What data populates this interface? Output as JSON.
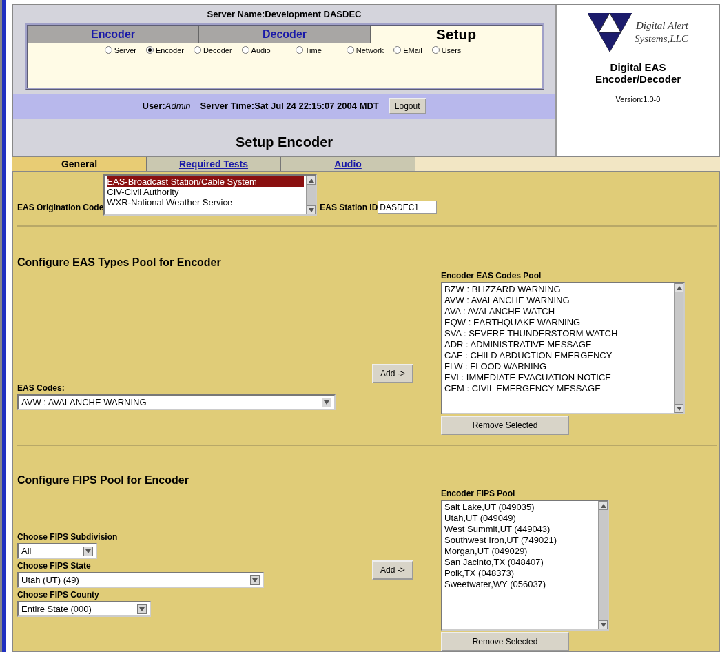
{
  "server_name": "Server Name:Development DASDEC",
  "nav_tabs": [
    {
      "label": "Encoder",
      "selected": false
    },
    {
      "label": "Decoder",
      "selected": false
    },
    {
      "label": "Setup",
      "selected": true
    }
  ],
  "setup_options": [
    {
      "label": "Server",
      "selected": false
    },
    {
      "label": "Encoder",
      "selected": true
    },
    {
      "label": "Decoder",
      "selected": false
    },
    {
      "label": "Audio",
      "selected": false
    },
    {
      "label": "Time",
      "selected": false
    },
    {
      "label": "Network",
      "selected": false
    },
    {
      "label": "EMail",
      "selected": false
    },
    {
      "label": "Users",
      "selected": false
    }
  ],
  "user_label": "User:",
  "user": "Admin",
  "server_time": "Server Time:Sat Jul 24 22:15:07 2004 MDT",
  "logout": "Logout",
  "page_title": "Setup Encoder",
  "logo": {
    "company_lines": [
      "Digital Alert",
      "Systems,LLC"
    ],
    "product_lines": [
      "Digital EAS",
      "Encoder/Decoder"
    ],
    "version": "Version:1.0-0"
  },
  "sub_tabs": [
    {
      "label": "General",
      "selected": true
    },
    {
      "label": "Required Tests",
      "selected": false
    },
    {
      "label": "Audio",
      "selected": false
    }
  ],
  "origination": {
    "label": "EAS Origination Code",
    "options": [
      {
        "label": "EAS-Broadcast Station/Cable System",
        "selected": true
      },
      {
        "label": "CIV-Civil Authority",
        "selected": false
      },
      {
        "label": "WXR-National Weather Service",
        "selected": false
      }
    ],
    "station_id_label": "EAS Station ID",
    "station_id": "DASDEC1"
  },
  "eas_section": {
    "title": "Configure EAS Types Pool for Encoder",
    "codes_label": "EAS Codes:",
    "codes_value": "AVW : AVALANCHE WARNING",
    "add": "Add ->",
    "pool_label": "Encoder EAS Codes Pool",
    "pool": [
      "BZW : BLIZZARD WARNING",
      "AVW : AVALANCHE WARNING",
      "AVA : AVALANCHE WATCH",
      "EQW : EARTHQUAKE WARNING",
      "SVA : SEVERE THUNDERSTORM WATCH",
      "ADR : ADMINISTRATIVE MESSAGE",
      "CAE : CHILD ABDUCTION EMERGENCY",
      "FLW : FLOOD WARNING",
      "EVI : IMMEDIATE EVACUATION NOTICE",
      "CEM : CIVIL EMERGENCY MESSAGE"
    ],
    "remove": "Remove Selected"
  },
  "fips_section": {
    "title": "Configure FIPS Pool for Encoder",
    "fields": [
      {
        "label": "Choose FIPS Subdivision",
        "value": "All",
        "kind": "short"
      },
      {
        "label": "Choose FIPS State",
        "value": "Utah (UT) (49)",
        "kind": "long"
      },
      {
        "label": "Choose FIPS County",
        "value": "Entire State (000)",
        "kind": "medium"
      }
    ],
    "add": "Add ->",
    "pool_label": "Encoder FIPS Pool",
    "pool": [
      "Salt Lake,UT (049035)",
      "Utah,UT (049049)",
      "West Summit,UT (449043)",
      "Southwest Iron,UT (749021)",
      "Morgan,UT (049029)",
      "San Jacinto,TX (048407)",
      "Polk,TX (048373)",
      "Sweetwater,WY (056037)"
    ],
    "remove": "Remove Selected"
  }
}
